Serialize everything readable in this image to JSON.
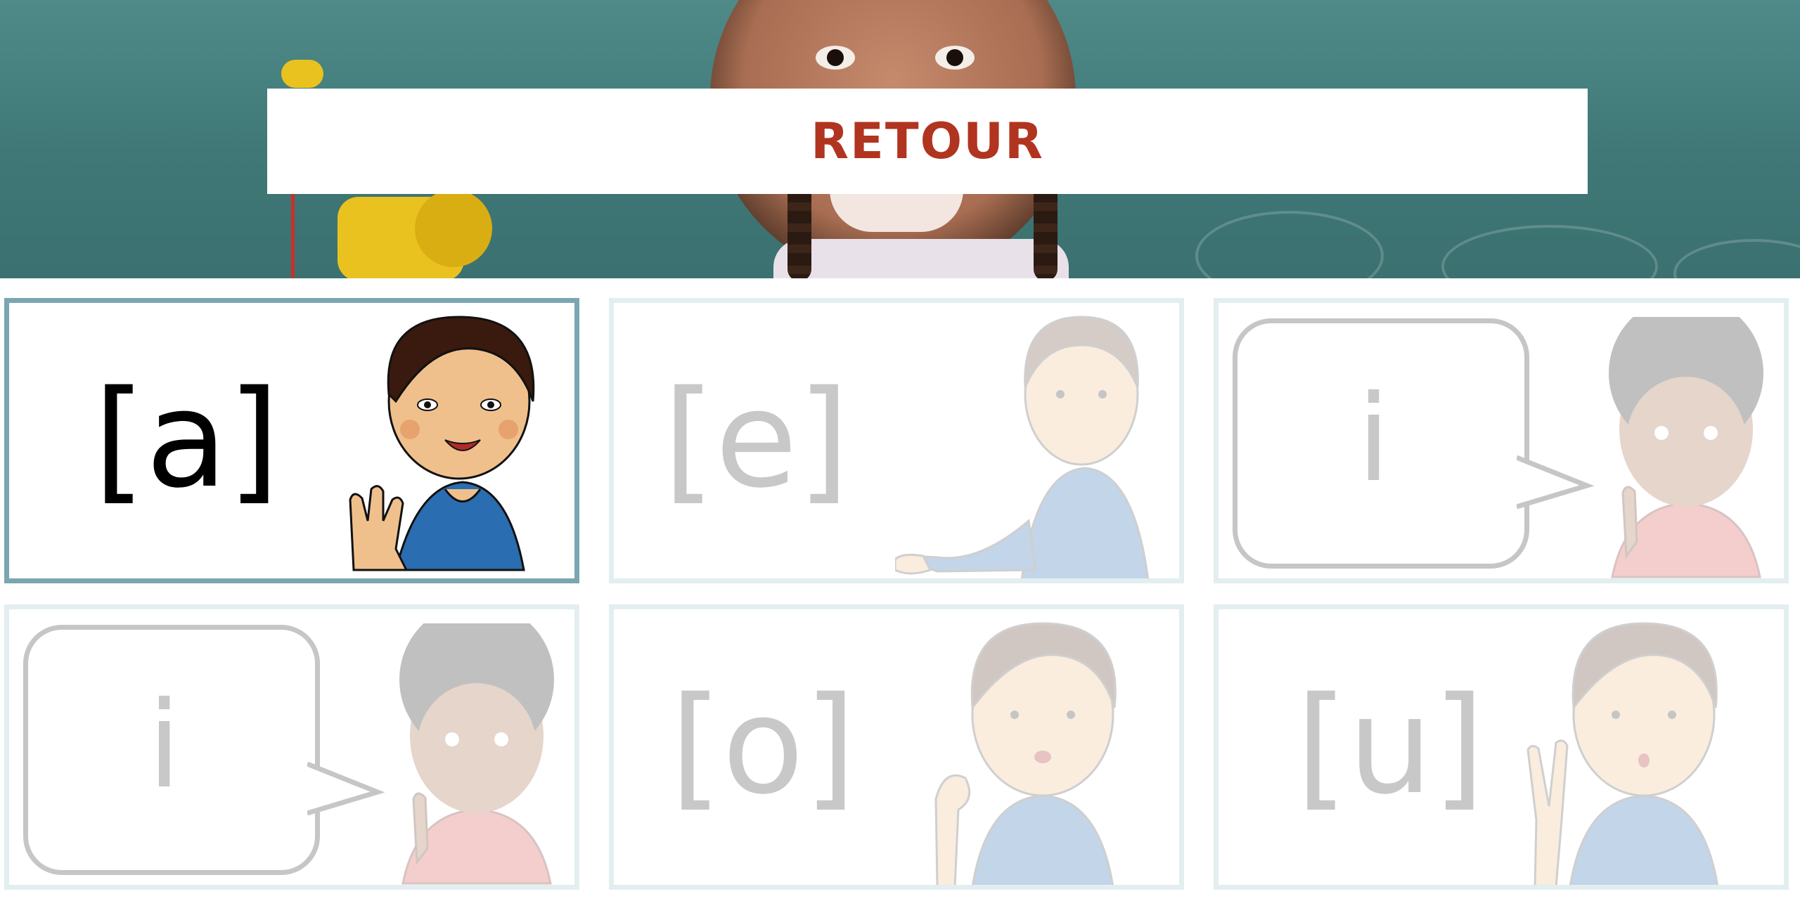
{
  "header": {
    "back_button_label": "RETOUR",
    "accent_color": "#b13420"
  },
  "cards": [
    {
      "label": "[a]",
      "state": "active"
    },
    {
      "label": "[e]",
      "state": "faded"
    },
    {
      "label": "i",
      "state": "faded"
    },
    {
      "label": "i",
      "state": "faded"
    },
    {
      "label": "[o]",
      "state": "faded"
    },
    {
      "label": "[u]",
      "state": "faded"
    }
  ]
}
